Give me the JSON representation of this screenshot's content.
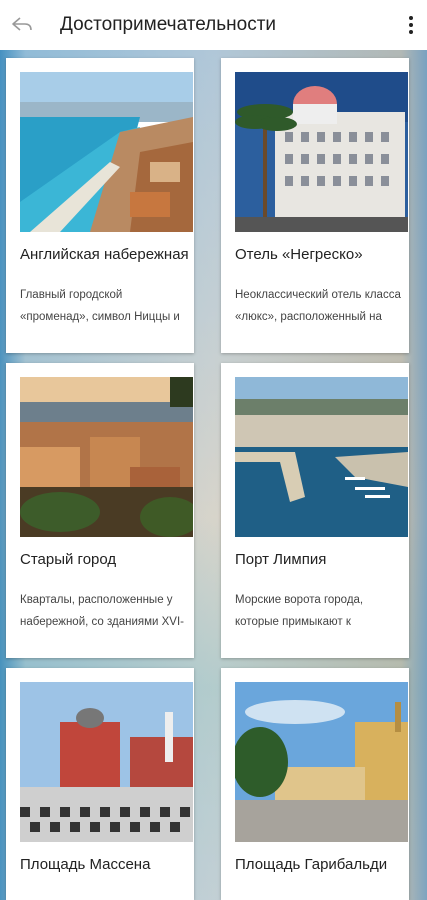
{
  "appbar": {
    "title": "Достопримечательности",
    "back_icon": "back-arrow-icon",
    "menu_icon": "more-vert-icon"
  },
  "places": [
    {
      "name": "Английская набережная",
      "description": "Главный городской «променад», символ Ниццы и",
      "photo": "promenade-photo"
    },
    {
      "name": "Отель «Негреско»",
      "description": "Неоклассический отель класса «люкс», расположенный на",
      "photo": "negresco-photo"
    },
    {
      "name": "Старый город",
      "description": "Кварталы, расположенные у набережной, со зданиями XVI-",
      "photo": "old-town-photo"
    },
    {
      "name": "Порт Лимпия",
      "description": "Морские ворота города, которые примыкают к",
      "photo": "port-photo"
    },
    {
      "name": "Площадь Массена",
      "description": "",
      "photo": "massena-photo"
    },
    {
      "name": "Площадь Гарибальди",
      "description": "",
      "photo": "garibaldi-photo"
    }
  ]
}
